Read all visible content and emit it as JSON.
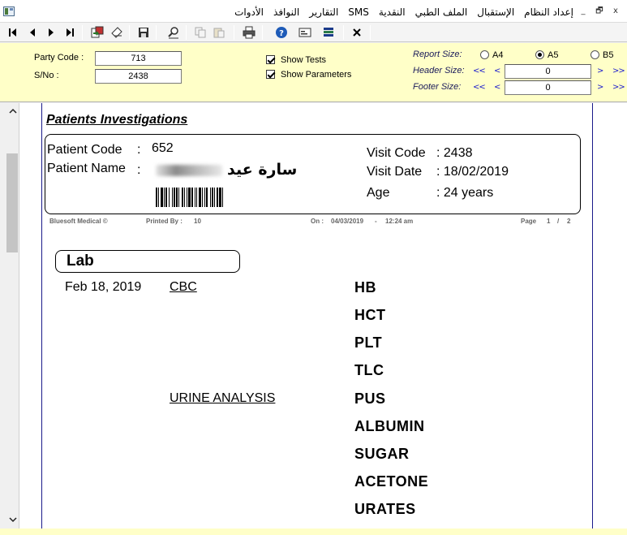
{
  "menu": {
    "items": [
      "إعداد النظام",
      "الإستقبال",
      "الملف الطبي",
      "النقدية",
      "SMS",
      "التقارير",
      "النوافذ",
      "الأدوات"
    ]
  },
  "window_controls": {
    "minimize": "_",
    "restore": "🗗",
    "close": "x"
  },
  "toolbar": {
    "icons": [
      "first-page-icon",
      "previous-page-icon",
      "next-page-icon",
      "last-page-icon",
      "export-icon",
      "eraser-icon",
      "save-icon",
      "zoom-icon",
      "copy-icon",
      "paste-icon",
      "print-icon",
      "help-icon",
      "email-icon",
      "stack-icon",
      "close-icon"
    ]
  },
  "params": {
    "party_code_label": "Party Code :",
    "party_code_value": "713",
    "sno_label": "S/No :",
    "sno_value": "2438",
    "show_tests_label": "Show Tests",
    "show_tests_checked": true,
    "show_parameters_label": "Show Parameters",
    "show_parameters_checked": true,
    "report_size_label": "Report Size:",
    "sizes": [
      "A4",
      "A5",
      "B5"
    ],
    "selected_size": "A5",
    "header_size_label": "Header Size:",
    "header_size_value": "0",
    "footer_size_label": "Footer Size:",
    "footer_size_value": "0",
    "nav_back_fast": "<<",
    "nav_back": "<",
    "nav_fwd": ">",
    "nav_fwd_fast": ">>"
  },
  "report": {
    "title": "Patients Investigations",
    "patient_code_label": "Patient Code",
    "patient_code_value": "652",
    "patient_name_label": "Patient Name",
    "patient_name_value": "سارة عيد",
    "colon": ":",
    "visit_code_label": "Visit Code",
    "visit_code_value": ": 2438",
    "visit_date_label": "Visit Date",
    "visit_date_value": ": 18/02/2019",
    "age_label": "Age",
    "age_value": ": 24 years",
    "footer_brand": "Bluesoft Medical ©",
    "printed_by_label": "Printed By :",
    "printed_by_value": "10",
    "on_label": "On :",
    "on_date": "04/03/2019",
    "dash": "-",
    "on_time": "12:24 am",
    "page_label": "Page",
    "page_current": "1",
    "page_sep": "/",
    "page_total": "2",
    "section": "Lab",
    "visit_date_long": "Feb 18, 2019",
    "groups": [
      {
        "name": "CBC",
        "tests": [
          "HB",
          "HCT",
          "PLT",
          "TLC"
        ]
      },
      {
        "name": "URINE ANALYSIS",
        "tests": [
          "PUS",
          "ALBUMIN",
          "SUGAR",
          "ACETONE",
          "URATES"
        ]
      }
    ]
  }
}
